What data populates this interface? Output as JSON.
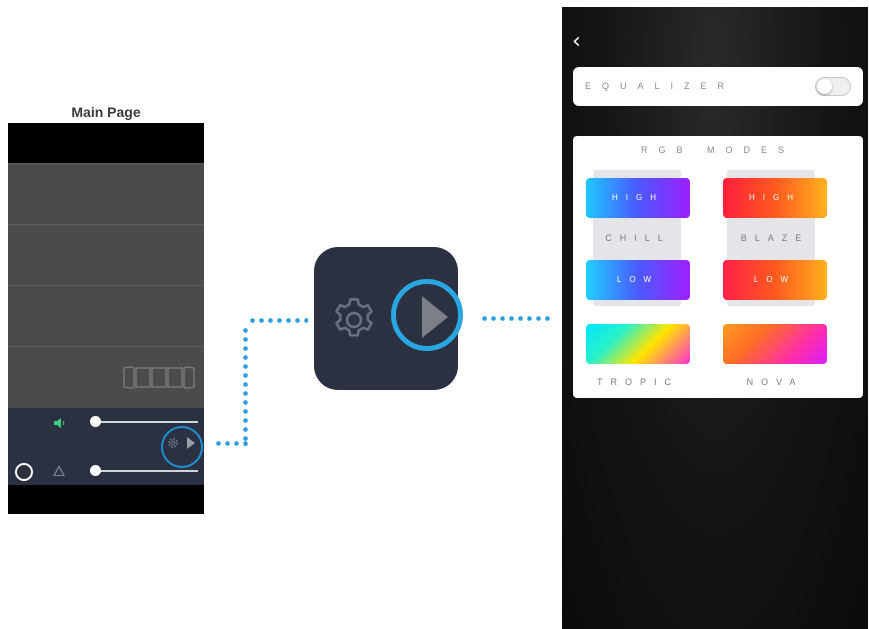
{
  "main_page": {
    "title": "Main Page",
    "icons": {
      "film": "film-strip-icon",
      "speaker": "speaker-icon",
      "gear": "gear-icon",
      "play": "play-icon",
      "circle": "circle-icon",
      "triangle": "triangle-icon"
    },
    "colors": {
      "highlight_ring": "#1e8fd0",
      "speaker": "#3fd07a"
    }
  },
  "zoom": {
    "icons": {
      "gear": "gear-icon",
      "play": "play-icon"
    },
    "colors": {
      "ring": "#2aa6e0",
      "tile": "#2b3140"
    }
  },
  "settings": {
    "back_icon": "‹",
    "equalizer": {
      "label": "EQUALIZER",
      "enabled": false
    },
    "rgb": {
      "title": "RGB MODES",
      "chill": {
        "label": "CHILL",
        "high": "HIGH",
        "low": "LOW"
      },
      "blaze": {
        "label": "BLAZE",
        "high": "HIGH",
        "low": "LOW"
      },
      "tropic": {
        "label": "TROPIC"
      },
      "nova": {
        "label": "NOVA"
      }
    }
  }
}
